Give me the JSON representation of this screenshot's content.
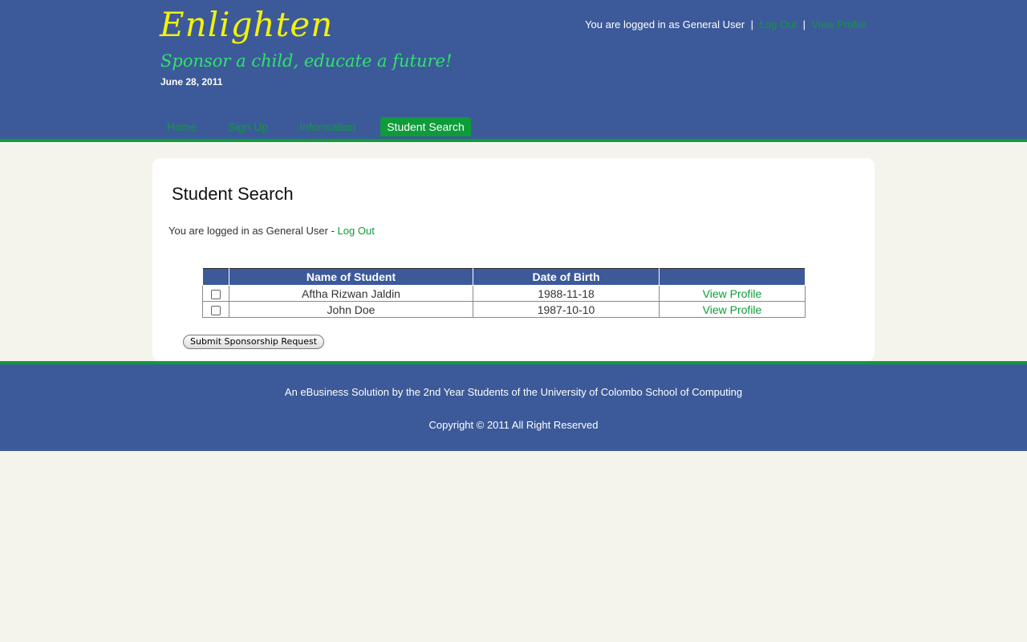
{
  "header": {
    "logo": "Enlighten",
    "tagline": "Sponsor a child, educate a future!",
    "date": "June 28, 2011",
    "user_status": "You are logged in as General User",
    "logout_link": "Log Out",
    "separator": "|",
    "view_profile_link": "View Profile"
  },
  "nav": {
    "items": [
      {
        "label": "Home"
      },
      {
        "label": "Sign Up"
      },
      {
        "label": "Information"
      },
      {
        "label": "Student Search"
      }
    ],
    "active": "Student Search"
  },
  "main": {
    "title": "Student Search",
    "login_text": "You are logged in as General User - ",
    "logout_link": "Log Out",
    "table": {
      "columns": [
        "",
        "Name of Student",
        "Date of Birth",
        ""
      ],
      "rows": [
        {
          "name": "Aftha Rizwan Jaldin",
          "dob": "1988-11-18",
          "action": "View Profile",
          "checked": false
        },
        {
          "name": "John Doe",
          "dob": "1987-10-10",
          "action": "View Profile",
          "checked": false
        }
      ]
    },
    "submit_label": "Submit Sponsorship Request"
  },
  "footer": {
    "line1": "An eBusiness Solution by the 2nd Year Students of the University of Colombo School of Computing",
    "line2": "Copyright © 2011 All Right Reserved"
  },
  "colors": {
    "header_bg": "#3c5a99",
    "accent_green": "#0e9b3a",
    "logo_yellow": "#f2f20a",
    "page_bg": "#f4f3ec"
  }
}
